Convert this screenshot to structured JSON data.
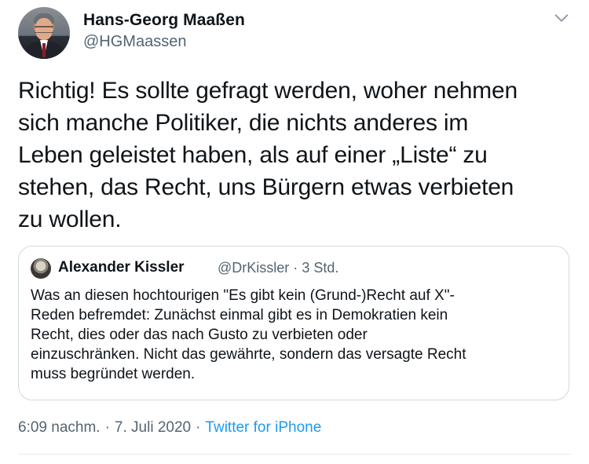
{
  "tweet": {
    "author": {
      "display_name": "Hans-Georg Maaßen",
      "handle": "@HGMaassen"
    },
    "more_icon": "chevron-down-icon",
    "text_lines": [
      "Richtig! Es sollte gefragt werden, woher nehmen",
      "sich manche Politiker, die nichts anderes im",
      "Leben geleistet haben, als auf einer „Liste“ zu",
      "stehen, das Recht, uns Bürgern etwas verbieten",
      "zu wollen."
    ],
    "quoted": {
      "display_name": "Alexander Kissler",
      "handle": "@DrKissler",
      "separator": "·",
      "time": "3 Std.",
      "text_lines": [
        "Was an diesen hochtourigen \"Es gibt kein (Grund-)Recht auf X\"-",
        "Reden befremdet: Zunächst einmal gibt es in Demokratien kein",
        "Recht, dies oder das nach Gusto zu verbieten oder",
        "einzuschränken. Nicht das gewährte, sondern das versagte Recht",
        "muss begründet werden."
      ]
    },
    "footer": {
      "time": "6:09 nachm.",
      "separator": "·",
      "date": "7. Juli 2020",
      "source": "Twitter for iPhone"
    }
  },
  "colors": {
    "text": "#0f1419",
    "secondary": "#536471",
    "link": "#1d9bf0",
    "border": "#cfd9de"
  }
}
